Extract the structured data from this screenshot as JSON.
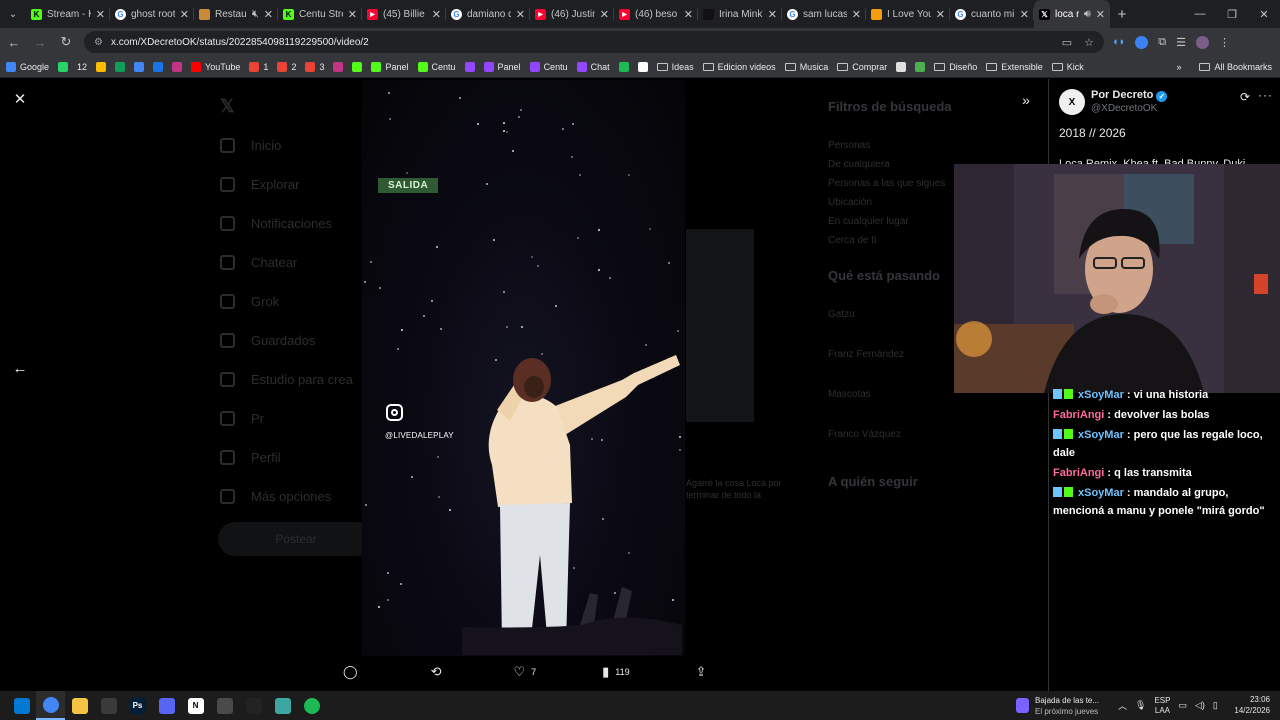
{
  "browser": {
    "tabs": [
      {
        "label": "Stream - K",
        "favicon": "kick-icon",
        "color": "#53fc18",
        "active": false
      },
      {
        "label": "ghost root",
        "favicon": "google-icon",
        "color": "#ffffff",
        "active": false
      },
      {
        "label": "Restau",
        "favicon": "image-icon",
        "color": "#c98a3a",
        "active": false,
        "muted": true
      },
      {
        "label": "Centu Stre",
        "favicon": "kick-icon",
        "color": "#53fc18",
        "active": false
      },
      {
        "label": "(45) Billie",
        "favicon": "youtube-icon",
        "color": "#ff0033",
        "active": false
      },
      {
        "label": "damiano d",
        "favicon": "google-icon",
        "color": "#ffffff",
        "active": false
      },
      {
        "label": "(46) Justin",
        "favicon": "youtube-icon",
        "color": "#ff0033",
        "active": false
      },
      {
        "label": "(46) beso",
        "favicon": "youtube-icon",
        "color": "#ff0033",
        "active": false
      },
      {
        "label": "Irina Mink",
        "favicon": "tiktok-icon",
        "color": "#111111",
        "active": false
      },
      {
        "label": "sam lucas",
        "favicon": "google-icon",
        "color": "#ffffff",
        "active": false
      },
      {
        "label": "I Love You",
        "favicon": "shield-icon",
        "color": "#f59e0b",
        "active": false
      },
      {
        "label": "cuanto mi",
        "favicon": "google-icon",
        "color": "#ffffff",
        "active": false
      },
      {
        "label": "loca re",
        "favicon": "x-icon",
        "color": "#000000",
        "active": true,
        "audio": true
      }
    ],
    "new_tab": "+",
    "url": "x.com/XDecretoOK/status/2022854098119229500/video/2",
    "bookmarks": [
      {
        "label": "Google",
        "icon": "google-icon",
        "color": "#4285f4"
      },
      {
        "label": "",
        "icon": "whatsapp-icon",
        "color": "#25d366"
      },
      {
        "label": "12",
        "icon": "",
        "color": ""
      },
      {
        "label": "",
        "icon": "drive-icon",
        "color": "#fbbc04"
      },
      {
        "label": "",
        "icon": "sheets-icon",
        "color": "#0f9d58"
      },
      {
        "label": "",
        "icon": "docs-icon",
        "color": "#4285f4"
      },
      {
        "label": "",
        "icon": "calendar-icon",
        "color": "#1a73e8"
      },
      {
        "label": "",
        "icon": "instagram-icon",
        "color": "#c13584"
      },
      {
        "label": "YouTube",
        "icon": "youtube-icon",
        "color": "#ff0000"
      },
      {
        "label": "1",
        "icon": "gmail-icon",
        "color": "#ea4335"
      },
      {
        "label": "2",
        "icon": "gmail-icon",
        "color": "#ea4335"
      },
      {
        "label": "3",
        "icon": "gmail-icon",
        "color": "#ea4335"
      },
      {
        "label": "",
        "icon": "instagram-icon",
        "color": "#c13584"
      },
      {
        "label": "",
        "icon": "kick-icon",
        "color": "#53fc18"
      },
      {
        "label": "Panel",
        "icon": "kick-icon",
        "color": "#53fc18"
      },
      {
        "label": "Centu",
        "icon": "kick-icon",
        "color": "#53fc18"
      },
      {
        "label": "",
        "icon": "twitch-icon",
        "color": "#9146ff"
      },
      {
        "label": "Panel",
        "icon": "twitch-icon",
        "color": "#9146ff"
      },
      {
        "label": "Centu",
        "icon": "twitch-icon",
        "color": "#9146ff"
      },
      {
        "label": "Chat",
        "icon": "twitch-icon",
        "color": "#9146ff"
      },
      {
        "label": "",
        "icon": "app-icon",
        "color": "#1db954"
      },
      {
        "label": "",
        "icon": "reddit-icon",
        "color": "#ffffff"
      },
      {
        "label": "Ideas",
        "icon": "folder-icon",
        "color": ""
      },
      {
        "label": "Edicion videos",
        "icon": "folder-icon",
        "color": ""
      },
      {
        "label": "Musica",
        "icon": "folder-icon",
        "color": ""
      },
      {
        "label": "Comprar",
        "icon": "folder-icon",
        "color": ""
      },
      {
        "label": "",
        "icon": "mug-icon",
        "color": "#e0e0e0"
      },
      {
        "label": "",
        "icon": "app-icon",
        "color": "#4caf50"
      },
      {
        "label": "Diseño",
        "icon": "folder-icon",
        "color": ""
      },
      {
        "label": "Extensible",
        "icon": "folder-icon",
        "color": ""
      },
      {
        "label": "Kick",
        "icon": "folder-icon",
        "color": ""
      }
    ],
    "bookmarks_overflow": "»",
    "all_bookmarks": "All Bookmarks"
  },
  "xpage": {
    "nav": [
      "Inicio",
      "Explorar",
      "Notificaciones",
      "Chatear",
      "Grok",
      "Guardados",
      "Estudio para crea",
      "Pr",
      "Perfil",
      "Más opciones"
    ],
    "post_button": "Postear",
    "filters_title": "Filtros de búsqueda",
    "filters": [
      "Personas",
      "De cualquiera",
      "Personas a las que sigues",
      "Ubicación",
      "En cualquier lugar",
      "Cerca de ti"
    ],
    "trending_title": "Qué está pasando",
    "trending": [
      "Gatzu",
      "Franz Fernández",
      "Mascotas",
      "Franco Vázquez"
    ],
    "follow_title": "A quién seguir",
    "middle_caption": "Agarré la cosa Loca por terminar de todo la"
  },
  "viewer": {
    "salida_tag": "SALIDA",
    "ig_handle": "@LIVEDALEPLAY",
    "actions": {
      "likes": "7",
      "views": "119"
    }
  },
  "post": {
    "author": "Por Decreto",
    "handle": "@XDecretoOK",
    "avatar_text": "X",
    "text": "2018 // 2026",
    "text2": "Loca Remix, Khea ft. Bad Bunny, Duki"
  },
  "chat": [
    {
      "user": "xSoyMar",
      "user_color": "#6ec4ff",
      "message": "vi una historia",
      "badges": true
    },
    {
      "user": "FabriAngi",
      "user_color": "#ff6b9d",
      "message": "devolver las bolas",
      "badges": false
    },
    {
      "user": "xSoyMar",
      "user_color": "#6ec4ff",
      "message": "pero que las regale loco, dale",
      "badges": true
    },
    {
      "user": "FabriAngi",
      "user_color": "#ff6b9d",
      "message": "q las transmita",
      "badges": false
    },
    {
      "user": "xSoyMar",
      "user_color": "#6ec4ff",
      "message": "mandalo al grupo, mencioná a manu y ponele \"mirá gordo\"",
      "badges": true
    }
  ],
  "taskbar": {
    "apps": [
      {
        "name": "windows-start-icon",
        "color": "#0078d4",
        "label": ""
      },
      {
        "name": "chrome-icon",
        "color": "#4285f4",
        "label": "",
        "active": true
      },
      {
        "name": "file-explorer-icon",
        "color": "#f6c343",
        "label": ""
      },
      {
        "name": "obs-icon",
        "color": "#3a3a3a",
        "label": ""
      },
      {
        "name": "photoshop-icon",
        "color": "#001e36",
        "label": "Ps"
      },
      {
        "name": "discord-icon",
        "color": "#5865f2",
        "label": ""
      },
      {
        "name": "notion-icon",
        "color": "#ffffff",
        "label": "N"
      },
      {
        "name": "calculator-icon",
        "color": "#4a4a4a",
        "label": ""
      },
      {
        "name": "capcut-icon",
        "color": "#222222",
        "label": ""
      },
      {
        "name": "app-icon",
        "color": "#3ba7a0",
        "label": ""
      },
      {
        "name": "spotify-icon",
        "color": "#1db954",
        "label": ""
      }
    ],
    "notification_title": "Bajada de las te...",
    "notification_sub": "El próximo jueves",
    "lang_top": "ESP",
    "lang_bottom": "LAA",
    "time": "23:06",
    "date": "14/2/2026"
  }
}
